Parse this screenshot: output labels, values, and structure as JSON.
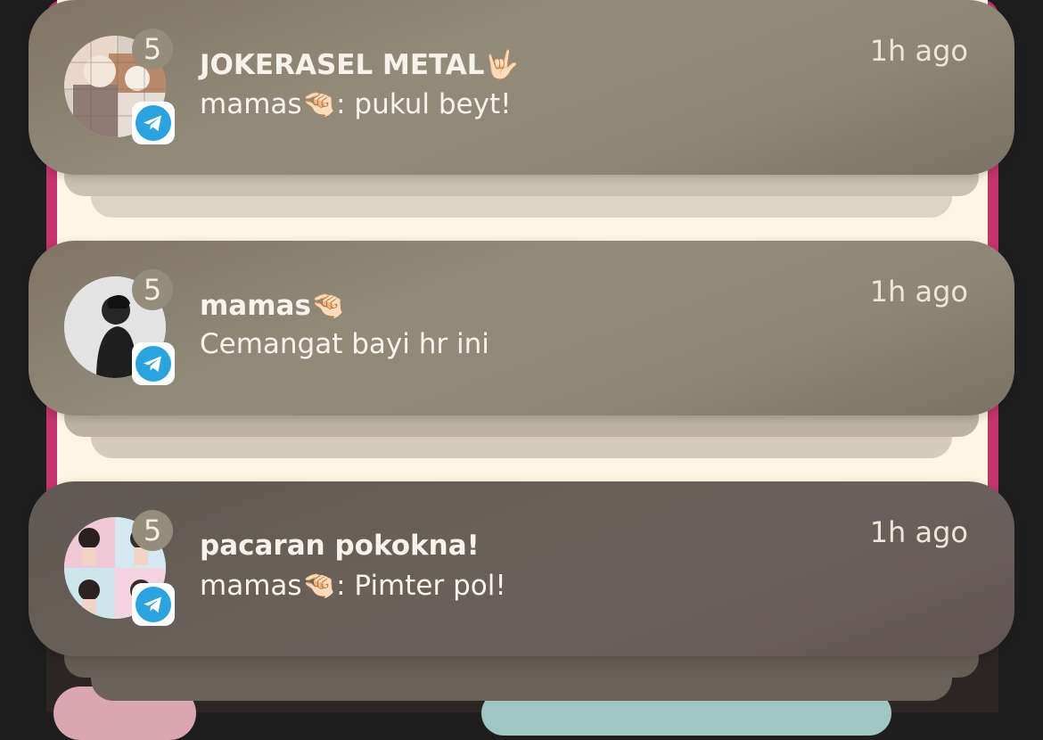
{
  "notifications": [
    {
      "title": "JOKERASEL METAL🤟🏻",
      "message": "mamas🤏🏻: pukul beyt!",
      "time": "1h ago",
      "count": "5",
      "app": "telegram-icon",
      "avatar": "group-photo-cats"
    },
    {
      "title": "mamas🤏🏻",
      "message": "Cemangat bayi hr ini",
      "time": "1h ago",
      "count": "5",
      "app": "telegram-icon",
      "avatar": "contact-photo-silhouette"
    },
    {
      "title": "pacaran pokokna!",
      "message": "mamas🤏🏻: Pimter pol!",
      "time": "1h ago",
      "count": "5",
      "app": "telegram-icon",
      "avatar": "group-photo-collage"
    }
  ],
  "colors": {
    "telegram_blue": "#2aa3df",
    "card_text": "#f7f3ec"
  }
}
